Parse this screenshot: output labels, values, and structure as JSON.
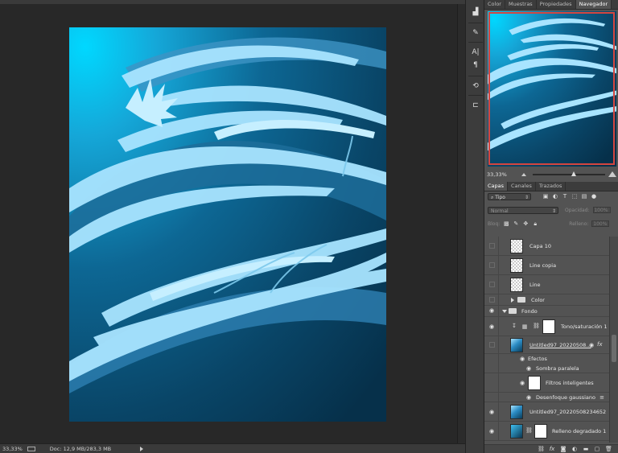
{
  "colors": {
    "canvas_bg": "#282828",
    "panel_bg": "#535353",
    "accent_frame": "#d4453f",
    "art_light": "#a8e4ff",
    "art_dark": "#0a3c5a"
  },
  "statusbar": {
    "zoom": "33,33%",
    "doc_info": "Doc: 12,9 MB/283,3 MB"
  },
  "toolstrip": {
    "icons": [
      "histogram-icon",
      "brush-preset-icon",
      "character-icon",
      "paragraph-icon",
      "history-icon",
      "tool-presets-icon"
    ]
  },
  "top_panel": {
    "tabs": [
      "Color",
      "Muestras",
      "Propiedades",
      "Navegador"
    ],
    "active_tab": "Navegador",
    "zoom": "33,33%"
  },
  "layers_panel": {
    "tabs": [
      "Capas",
      "Canales",
      "Trazados"
    ],
    "active_tab": "Capas",
    "filter_kind": "Tipo",
    "blend_mode": "Normal",
    "opacity_label": "Opacidad:",
    "opacity_value": "100%",
    "lock_label": "Bloq:",
    "fill_label": "Relleno:",
    "fill_value": "100%",
    "layers": [
      {
        "name": "Capa 10",
        "visible": false
      },
      {
        "name": "Line copia",
        "visible": false
      },
      {
        "name": "Line",
        "visible": false
      },
      {
        "name": "Color",
        "visible": false,
        "type": "group"
      },
      {
        "name": "Fondo",
        "visible": true,
        "type": "group"
      },
      {
        "name": "Tono/saturación 1",
        "visible": true,
        "type": "adjustment"
      },
      {
        "name": "Untitled97_20220508...",
        "visible": false,
        "type": "smart"
      },
      {
        "name": "Efectos",
        "type": "effects"
      },
      {
        "name": "Sombra paralela",
        "type": "effect"
      },
      {
        "name": "Filtros inteligentes",
        "type": "smart-filters"
      },
      {
        "name": "Desenfoque gaussiano",
        "type": "filter"
      },
      {
        "name": "Untitled97_20220508234652",
        "visible": true,
        "type": "smart"
      },
      {
        "name": "Relleno degradado 1",
        "visible": true,
        "type": "fill"
      }
    ]
  }
}
